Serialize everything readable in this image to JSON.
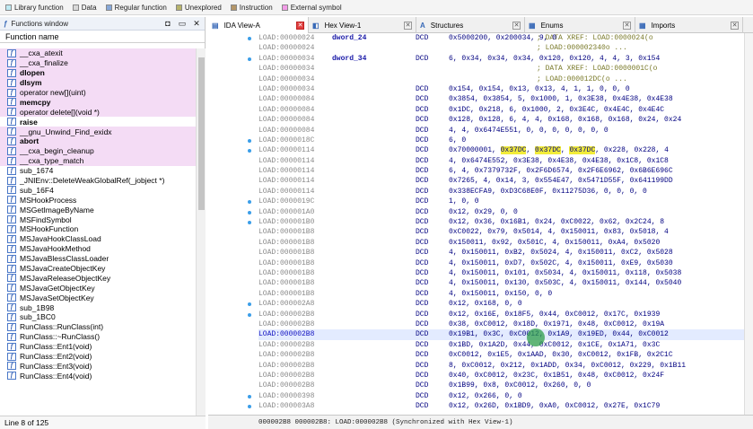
{
  "legend": [
    {
      "label": "Library function",
      "color": "#bfeaf3"
    },
    {
      "label": "Data",
      "color": "#d9d9d9"
    },
    {
      "label": "Regular function",
      "color": "#87a8d8"
    },
    {
      "label": "Unexplored",
      "color": "#b7b36b"
    },
    {
      "label": "Instruction",
      "color": "#b49668"
    },
    {
      "label": "External symbol",
      "color": "#f39ce8"
    }
  ],
  "functions_window": {
    "title": "Functions window",
    "column_header": "Function name",
    "status": "Line 8 of 125",
    "items": [
      {
        "name": "__cxa_atexit",
        "lib": true,
        "bold": false
      },
      {
        "name": "__cxa_finalize",
        "lib": true,
        "bold": false
      },
      {
        "name": "dlopen",
        "lib": true,
        "bold": true
      },
      {
        "name": "dlsym",
        "lib": true,
        "bold": true
      },
      {
        "name": "operator new[](uint)",
        "lib": true,
        "bold": false
      },
      {
        "name": "memcpy",
        "lib": true,
        "bold": true
      },
      {
        "name": "operator delete[](void *)",
        "lib": true,
        "bold": false
      },
      {
        "name": "raise",
        "lib": false,
        "bold": true
      },
      {
        "name": "__gnu_Unwind_Find_exidx",
        "lib": true,
        "bold": false
      },
      {
        "name": "abort",
        "lib": true,
        "bold": true
      },
      {
        "name": "__cxa_begin_cleanup",
        "lib": true,
        "bold": false
      },
      {
        "name": "__cxa_type_match",
        "lib": true,
        "bold": false
      },
      {
        "name": "sub_1674",
        "lib": false,
        "bold": false
      },
      {
        "name": "_JNIEnv::DeleteWeakGlobalRef(_jobject *)",
        "lib": false,
        "bold": false
      },
      {
        "name": "sub_16F4",
        "lib": false,
        "bold": false
      },
      {
        "name": "MSHookProcess",
        "lib": false,
        "bold": false
      },
      {
        "name": "MSGetImageByName",
        "lib": false,
        "bold": false
      },
      {
        "name": "MSFindSymbol",
        "lib": false,
        "bold": false
      },
      {
        "name": "MSHookFunction",
        "lib": false,
        "bold": false
      },
      {
        "name": "MSJavaHookClassLoad",
        "lib": false,
        "bold": false
      },
      {
        "name": "MSJavaHookMethod",
        "lib": false,
        "bold": false
      },
      {
        "name": "MSJavaBlessClassLoader",
        "lib": false,
        "bold": false
      },
      {
        "name": "MSJavaCreateObjectKey",
        "lib": false,
        "bold": false
      },
      {
        "name": "MSJavaReleaseObjectKey",
        "lib": false,
        "bold": false
      },
      {
        "name": "MSJavaGetObjectKey",
        "lib": false,
        "bold": false
      },
      {
        "name": "MSJavaSetObjectKey",
        "lib": false,
        "bold": false
      },
      {
        "name": "sub_1B98",
        "lib": false,
        "bold": false
      },
      {
        "name": "sub_1BC0",
        "lib": false,
        "bold": false
      },
      {
        "name": "RunClass::RunClass(int)",
        "lib": false,
        "bold": false
      },
      {
        "name": "RunClass::~RunClass()",
        "lib": false,
        "bold": false
      },
      {
        "name": "RunClass::Ent1(void)",
        "lib": false,
        "bold": false
      },
      {
        "name": "RunClass::Ent2(void)",
        "lib": false,
        "bold": false
      },
      {
        "name": "RunClass::Ent3(void)",
        "lib": false,
        "bold": false
      },
      {
        "name": "RunClass::Ent4(void)",
        "lib": false,
        "bold": false
      }
    ]
  },
  "tabs": [
    {
      "label": "IDA View-A",
      "active": true,
      "width": 112
    },
    {
      "label": "Hex View-1",
      "active": false,
      "width": 120
    },
    {
      "label": "Structures",
      "active": false,
      "width": 121
    },
    {
      "label": "Enums",
      "active": false,
      "width": 123
    },
    {
      "label": "Imports",
      "active": false,
      "width": 120
    }
  ],
  "ida_view": {
    "lines": [
      {
        "addr": "LOAD:00000024",
        "label": "dword_24",
        "mn": "DCD",
        "op": "0x5000200, 0x200034, 9, 0",
        "cm": "; DATA XREF: LOAD:0000024(o",
        "dot": true
      },
      {
        "addr": "LOAD:00000024",
        "label": "",
        "mn": "",
        "op": "",
        "cm": "; LOAD:000002340o ..."
      },
      {
        "addr": "LOAD:00000034",
        "label": "dword_34",
        "mn": "DCD",
        "op": "6, 0x34, 0x34, 0x34, 0x120, 0x120, 4, 4, 3, 0x154",
        "cm": "",
        "dot": true
      },
      {
        "addr": "LOAD:00000034",
        "label": "",
        "mn": "",
        "op": "",
        "cm": "; DATA XREF: LOAD:0000001C(o"
      },
      {
        "addr": "LOAD:00000034",
        "label": "",
        "mn": "",
        "op": "",
        "cm": "; LOAD:000012DC(o ..."
      },
      {
        "addr": "LOAD:00000034",
        "label": "",
        "mn": "DCD",
        "op": "0x154, 0x154, 0x13, 0x13, 4, 1, 1, 0, 0, 0"
      },
      {
        "addr": "LOAD:00000084",
        "label": "",
        "mn": "DCD",
        "op": "0x3854, 0x3854, 5, 0x1000, 1, 0x3E38, 0x4E38, 0x4E38"
      },
      {
        "addr": "LOAD:00000084",
        "label": "",
        "mn": "DCD",
        "op": "0x1DC, 0x218, 6, 0x1000, 2, 0x3E4C, 0x4E4C, 0x4E4C"
      },
      {
        "addr": "LOAD:00000084",
        "label": "",
        "mn": "DCD",
        "op": "0x128, 0x128, 6, 4, 4, 0x168, 0x168, 0x168, 0x24, 0x24"
      },
      {
        "addr": "LOAD:00000084",
        "label": "",
        "mn": "DCD",
        "op": "4, 4, 0x6474E551, 0, 0, 0, 0, 0, 0, 0"
      },
      {
        "addr": "LOAD:0000018C",
        "label": "",
        "mn": "DCD",
        "op": "6, 0",
        "dot": true
      },
      {
        "addr": "LOAD:00000114",
        "label": "",
        "mn": "DCD",
        "op": "0x70000001, <y>0x37DC</y>, <y>0x37DC</y>, <y>0x37DC</y>, 0x228, 0x228, 4",
        "dot": true
      },
      {
        "addr": "LOAD:00000114",
        "label": "",
        "mn": "DCD",
        "op": "4, 0x6474E552, 0x3E38, 0x4E38, 0x4E38, 0x1C8, 0x1C8"
      },
      {
        "addr": "LOAD:00000114",
        "label": "",
        "mn": "DCD",
        "op": "6, 4, 0x7379732F, 0x2F6D6574, 0x2F6E6962, 0x6B6E696C"
      },
      {
        "addr": "LOAD:00000114",
        "label": "",
        "mn": "DCD",
        "op": "0x7265, 4, 0x14, 3, 0x554E47, 0x5471D55F, 0x641199DD"
      },
      {
        "addr": "LOAD:00000114",
        "label": "",
        "mn": "DCD",
        "op": "0x338ECFA9, 0xD3C68E0F, 0x11275D36, 0, 0, 0, 0"
      },
      {
        "addr": "LOAD:0000019C",
        "label": "",
        "mn": "DCD",
        "op": "1, 0, 0",
        "dot": true
      },
      {
        "addr": "LOAD:000001A0",
        "label": "",
        "mn": "DCD",
        "op": "0x12, 0x29, 0, 0",
        "dot": true
      },
      {
        "addr": "LOAD:000001B0",
        "label": "",
        "mn": "DCD",
        "op": "0x12, 0x36, 0x16B1, 0x24, 0xC0022, 0x62, 0x2C24, 8",
        "dot": true
      },
      {
        "addr": "LOAD:000001B8",
        "label": "",
        "mn": "DCD",
        "op": "0xC0022, 0x79, 0x5014, 4, 0x150011, 0x83, 0x5018, 4"
      },
      {
        "addr": "LOAD:000001B8",
        "label": "",
        "mn": "DCD",
        "op": "0x150011, 0x92, 0x501C, 4, 0x150011, 0xA4, 0x5020"
      },
      {
        "addr": "LOAD:000001B8",
        "label": "",
        "mn": "DCD",
        "op": "4, 0x150011, 0xB2, 0x5024, 4, 0x150011, 0xC2, 0x5028"
      },
      {
        "addr": "LOAD:000001B8",
        "label": "",
        "mn": "DCD",
        "op": "4, 0x150011, 0xD7, 0x502C, 4, 0x150011, 0xE9, 0x5030"
      },
      {
        "addr": "LOAD:000001B8",
        "label": "",
        "mn": "DCD",
        "op": "4, 0x150011, 0x101, 0x5034, 4, 0x150011, 0x118, 0x5038"
      },
      {
        "addr": "LOAD:000001B8",
        "label": "",
        "mn": "DCD",
        "op": "4, 0x150011, 0x130, 0x503C, 4, 0x150011, 0x144, 0x5040"
      },
      {
        "addr": "LOAD:000001B8",
        "label": "",
        "mn": "DCD",
        "op": "4, 0x150011, 0x150, 0, 0"
      },
      {
        "addr": "LOAD:000002A8",
        "label": "",
        "mn": "DCD",
        "op": "0x12, 0x168, 0, 0",
        "dot": true
      },
      {
        "addr": "LOAD:000002B8",
        "label": "",
        "mn": "DCD",
        "op": "0x12, 0x16E, 0x18F5, 0x44, 0xC0012, 0x17C, 0x1939",
        "dot": true
      },
      {
        "addr": "LOAD:000002B8",
        "label": "",
        "mn": "DCD",
        "op": "0x38, 0xC0012, 0x18D, 0x1971, 0x48, 0xC0012, 0x19A"
      },
      {
        "addr": "LOAD:000002B8",
        "label": "",
        "mn": "DCD",
        "op": "0x19B1, 0x3C, 0xC0012, 0x1A9, 0x19ED, 0x44, 0xC0012",
        "hl": true
      },
      {
        "addr": "LOAD:000002B8",
        "label": "",
        "mn": "DCD",
        "op": "0x1BD, 0x1A2D, 0x44, 0xC0012, 0x1CE, 0x1A71, 0x3C"
      },
      {
        "addr": "LOAD:000002B8",
        "label": "",
        "mn": "DCD",
        "op": "0xC0012, 0x1E5, 0x1AAD, 0x30, 0xC0012, 0x1FB, 0x2C1C"
      },
      {
        "addr": "LOAD:000002B8",
        "label": "",
        "mn": "DCD",
        "op": "8, 0xC0012, 0x212, 0x1ADD, 0x34, 0xC0012, 0x229, 0x1B11"
      },
      {
        "addr": "LOAD:000002B8",
        "label": "",
        "mn": "DCD",
        "op": "0x40, 0xC0012, 0x23C, 0x1B51, 0x48, 0xC0012, 0x24F"
      },
      {
        "addr": "LOAD:000002B8",
        "label": "",
        "mn": "DCD",
        "op": "0x1B99, 0x8, 0xC0012, 0x260, 0, 0"
      },
      {
        "addr": "LOAD:00000398",
        "label": "",
        "mn": "DCD",
        "op": "0x12, 0x266, 0, 0",
        "dot": true
      },
      {
        "addr": "LOAD:000003A8",
        "label": "",
        "mn": "DCD",
        "op": "0x12, 0x26D, 0x1BD9, 0xA0, 0xC0012, 0x27E, 0x1C79",
        "dot": true
      }
    ]
  },
  "status_bar": "000002B8 000002B8: LOAD:000002B8 (Synchronized with Hex View-1)"
}
